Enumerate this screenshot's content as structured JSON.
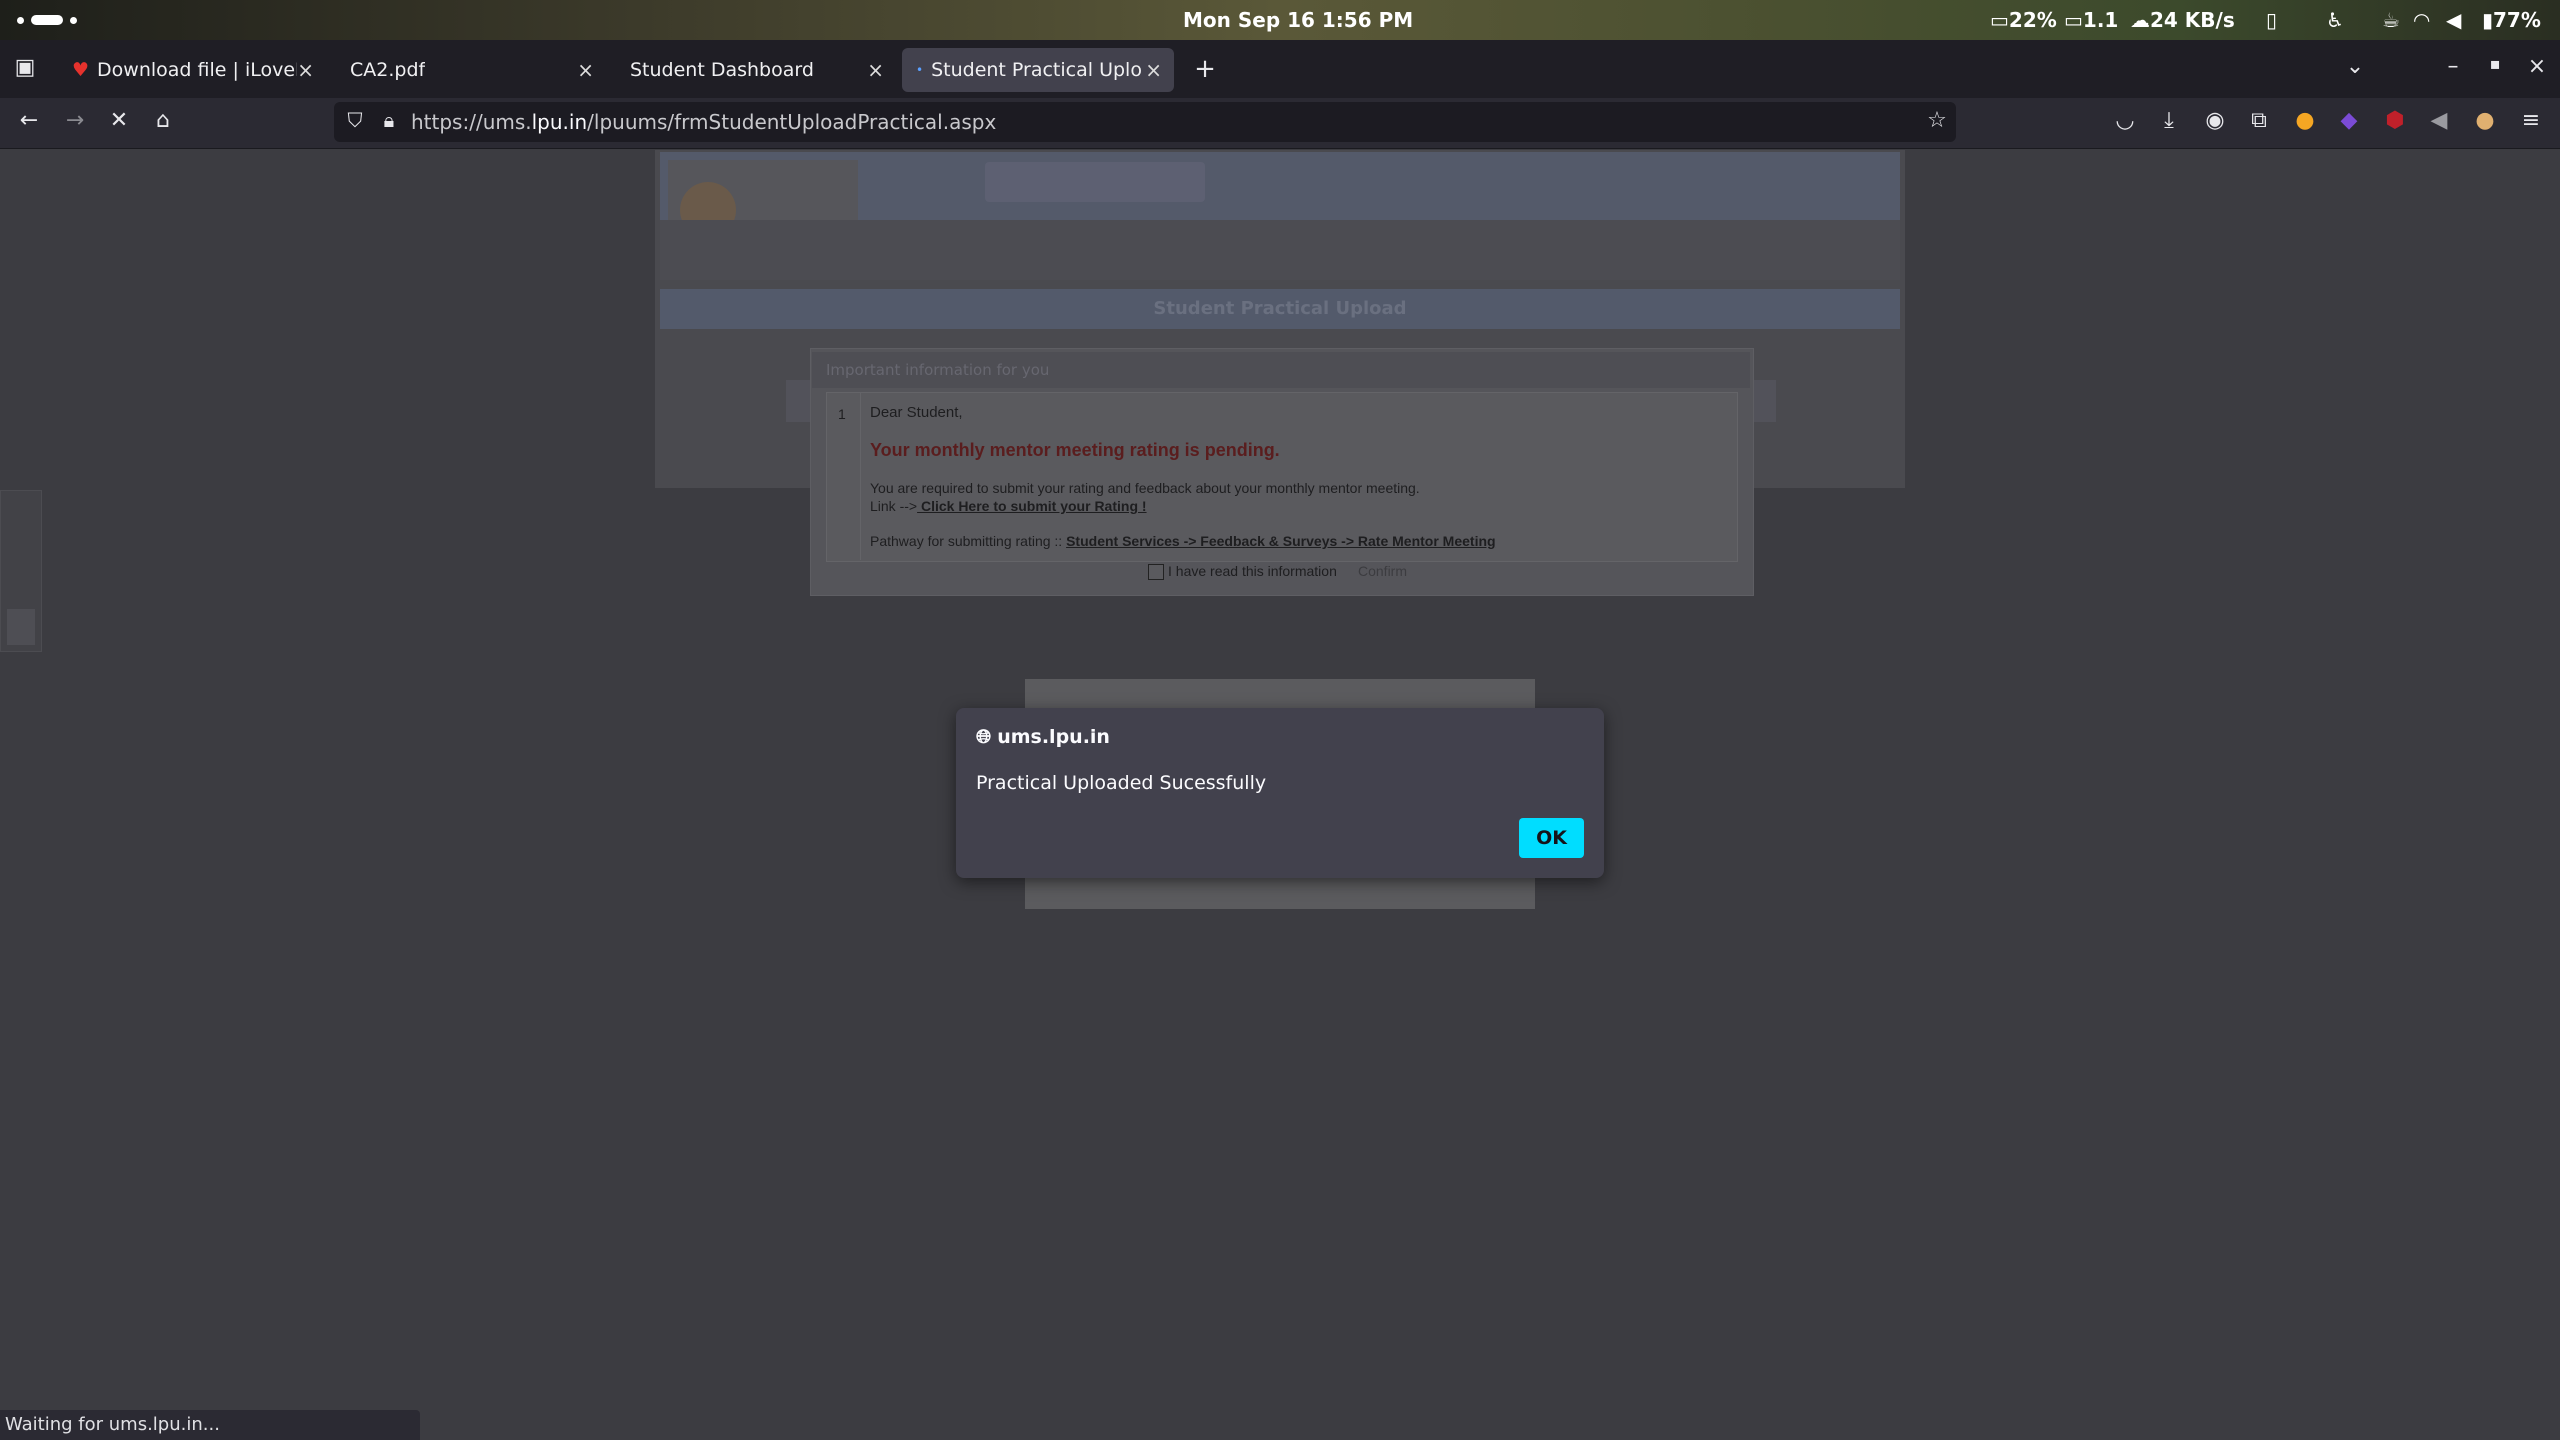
{
  "system_bar": {
    "clock": "Mon Sep 16    1:56 PM",
    "cpu": "22%",
    "load": "1.1",
    "network": "24 KB/s",
    "battery": "77%"
  },
  "tabs": [
    {
      "label": "Download file | iLovePDF",
      "active": false
    },
    {
      "label": "CA2.pdf",
      "active": false
    },
    {
      "label": "Student Dashboard",
      "active": false
    },
    {
      "label": "Student Practical Upload",
      "active": true
    }
  ],
  "url": {
    "prefix": "https://ums.",
    "domain": "lpu.in",
    "path": "/lpuums/frmStudentUploadPractical.aspx"
  },
  "background_page": {
    "title": "Student Practical Upload",
    "modal_heading": "Important information for you",
    "row_number": "1",
    "greeting": "Dear Student,",
    "headline": "Your monthly mentor meeting rating is pending.",
    "body_line": "You are required to submit your rating and feedback about your monthly mentor meeting.",
    "link_prefix": "Link -->",
    "link_text": " Click Here to submit your Rating !",
    "pathway_prefix": "Pathway for submitting rating :: ",
    "pathway_link": "Student Services -> Feedback & Surveys -> Rate Mentor Meeting",
    "checkbox_label": "I have read this information",
    "confirm_label": "Confirm"
  },
  "alert": {
    "origin": "ums.lpu.in",
    "message": "Practical Uploaded Sucessfully",
    "ok_label": "OK"
  },
  "status_text": "Waiting for ums.lpu.in...",
  "colors": {
    "accent": "#00ddff",
    "dialog_bg": "#42414d",
    "tab_active": "#42414d"
  }
}
